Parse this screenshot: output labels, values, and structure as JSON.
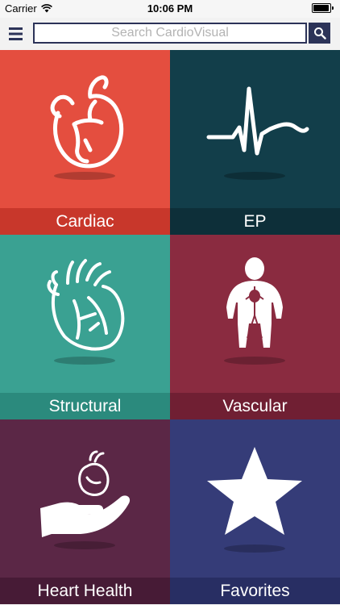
{
  "status_bar": {
    "carrier": "Carrier",
    "time": "10:06 PM"
  },
  "header": {
    "search_placeholder": "Search CardioVisual"
  },
  "tiles": [
    {
      "label": "Cardiac",
      "bg": "#e44e3f",
      "band": "#c8372b",
      "icon": "heart-icon"
    },
    {
      "label": "EP",
      "bg": "#123e4a",
      "band": "#0d2f39",
      "icon": "ecg-waveform-icon"
    },
    {
      "label": "Structural",
      "bg": "#3aa192",
      "band": "#2b8a7d",
      "icon": "anatomical-heart-icon"
    },
    {
      "label": "Vascular",
      "bg": "#8a2b40",
      "band": "#701f33",
      "icon": "body-vessels-icon"
    },
    {
      "label": "Heart Health",
      "bg": "#5b2746",
      "band": "#471b36",
      "icon": "hand-heart-icon"
    },
    {
      "label": "Favorites",
      "bg": "#353c78",
      "band": "#282e63",
      "icon": "star-icon"
    }
  ]
}
